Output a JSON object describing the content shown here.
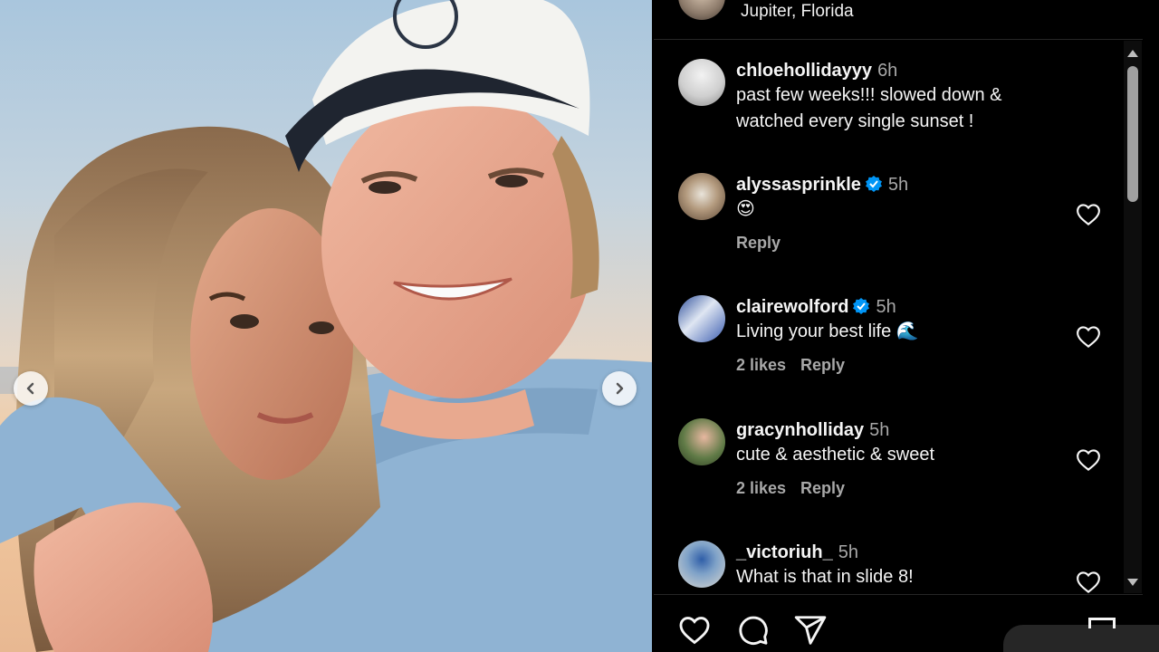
{
  "post": {
    "location": "Jupiter, Florida"
  },
  "comments": [
    {
      "username": "chloehollidayyy",
      "time": "6h",
      "verified": false,
      "text_lines": [
        "past few weeks!!! slowed down &",
        "watched every single sunset !"
      ],
      "likes": "",
      "reply": ""
    },
    {
      "username": "alyssasprinkle",
      "time": "5h",
      "verified": true,
      "text_lines": [
        "😍"
      ],
      "likes": "",
      "reply": "Reply"
    },
    {
      "username": "clairewolford",
      "time": "5h",
      "verified": true,
      "text_lines": [
        "Living your best life 🌊"
      ],
      "likes": "2 likes",
      "reply": "Reply"
    },
    {
      "username": "gracynholliday",
      "time": "5h",
      "verified": false,
      "text_lines": [
        "cute & aesthetic & sweet"
      ],
      "likes": "2 likes",
      "reply": "Reply"
    },
    {
      "username": "_victoriuh_",
      "time": "5h",
      "verified": false,
      "text_lines": [
        "What is that in slide 8!"
      ],
      "likes": "",
      "reply": ""
    }
  ],
  "icons": {
    "like": "heart-icon",
    "comment": "comment-icon",
    "share": "share-icon",
    "bookmark": "bookmark-icon",
    "prev": "chevron-left-icon",
    "next": "chevron-right-icon",
    "verified": "verified-badge-icon"
  },
  "colors": {
    "background": "#000000",
    "text": "#f5f5f5",
    "secondary_text": "#a8a8a8",
    "verified": "#0095f6",
    "sweater": "#8fb3d3"
  }
}
